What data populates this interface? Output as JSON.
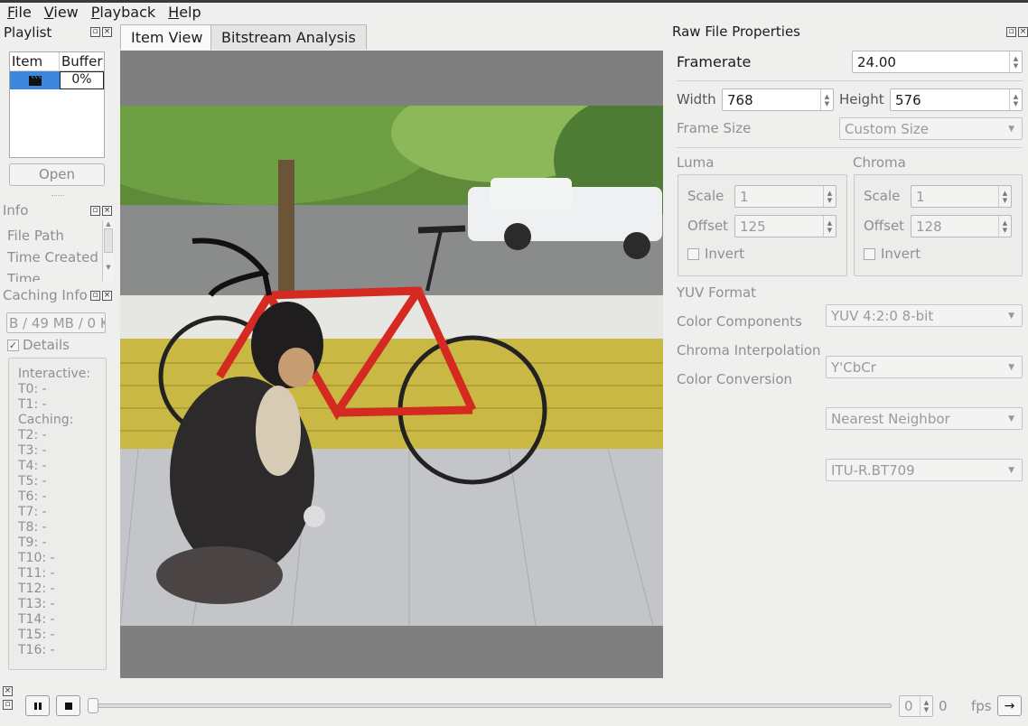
{
  "menu": [
    "File",
    "View",
    "Playback",
    "Help"
  ],
  "playlist": {
    "title": "Playlist",
    "col_item": "Item",
    "col_buffer": "Buffer",
    "row_buffer": "0%",
    "open_label": "Open"
  },
  "info": {
    "title": "Info",
    "rows": [
      "File Path",
      "Time Created",
      "Time Modified"
    ]
  },
  "caching": {
    "title": "Caching Info",
    "memory_value": "B / 49 MB / 0 K",
    "details_label": "Details",
    "details_lines": [
      "Interactive:",
      "T0: -",
      "T1: -",
      "Caching:",
      "T2: -",
      "T3: -",
      "T4: -",
      "T5: -",
      "T6: -",
      "T7: -",
      "T8: -",
      "T9: -",
      "T10: -",
      "T11: -",
      "T12: -",
      "T13: -",
      "T14: -",
      "T15: -",
      "T16: -"
    ]
  },
  "tabs": [
    "Item View",
    "Bitstream Analysis"
  ],
  "props": {
    "title": "Raw File Properties",
    "framerate_label": "Framerate",
    "framerate_value": "24.00",
    "width_label": "Width",
    "width_value": "768",
    "height_label": "Height",
    "height_value": "576",
    "frame_size_label": "Frame Size",
    "frame_size_value": "Custom Size",
    "luma": {
      "title": "Luma",
      "scale_label": "Scale",
      "scale_value": "1",
      "offset_label": "Offset",
      "offset_value": "125",
      "invert_label": "Invert"
    },
    "chroma": {
      "title": "Chroma",
      "scale_label": "Scale",
      "scale_value": "1",
      "offset_label": "Offset",
      "offset_value": "128",
      "invert_label": "Invert"
    },
    "yuv_format_label": "YUV Format",
    "yuv_format_value": "YUV 4:2:0 8-bit",
    "color_components_label": "Color Components",
    "color_components_value": "Y'CbCr",
    "chroma_interp_label": "Chroma Interpolation",
    "chroma_interp_value": "Nearest Neighbor",
    "color_conversion_label": "Color Conversion",
    "color_conversion_value": "ITU-R.BT709"
  },
  "playback": {
    "frame_value": "0",
    "frame_max": "0",
    "fps_label": "fps",
    "next_label": "→"
  },
  "colors": {
    "selection": "#3d86de",
    "view_bg": "#7f7f7f",
    "bike_red": "#d42a22"
  }
}
